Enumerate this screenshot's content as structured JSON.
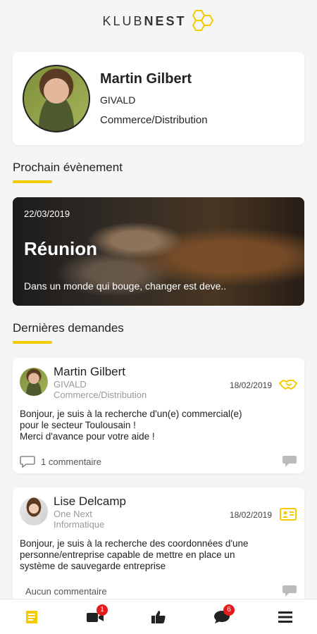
{
  "app": {
    "logo_text_light": "KLUB",
    "logo_text_bold": "NEST"
  },
  "profile": {
    "name": "Martin Gilbert",
    "company": "GIVALD",
    "sector": "Commerce/Distribution"
  },
  "events_section": {
    "title": "Prochain évènement"
  },
  "event": {
    "date": "22/03/2019",
    "title": "Réunion",
    "description": "Dans un monde qui bouge, changer est deve.."
  },
  "requests_section": {
    "title": "Dernières demandes"
  },
  "requests": [
    {
      "name": "Martin Gilbert",
      "company": "GIVALD",
      "sector": "Commerce/Distribution",
      "date": "18/02/2019",
      "type_icon": "handshake-icon",
      "body_lines": [
        "Bonjour, je suis à la recherche d'un(e) commercial(e)",
        "pour le secteur Toulousain !",
        "Merci d'avance pour votre aide !"
      ],
      "comments": "1 commentaire"
    },
    {
      "name": "Lise Delcamp",
      "company": "One Next",
      "sector": "Informatique",
      "date": "18/02/2019",
      "type_icon": "contact-card-icon",
      "body_lines": [
        "Bonjour, je suis à la recherche des coordonnées d'une",
        "personne/entreprise capable de mettre en place un",
        "système de sauvegarde entreprise"
      ],
      "comments": "Aucun commentaire"
    }
  ],
  "nav": {
    "video_badge": "1",
    "messages_badge": "6"
  },
  "colors": {
    "accent": "#f2cc00",
    "badge": "#e51b1b"
  }
}
